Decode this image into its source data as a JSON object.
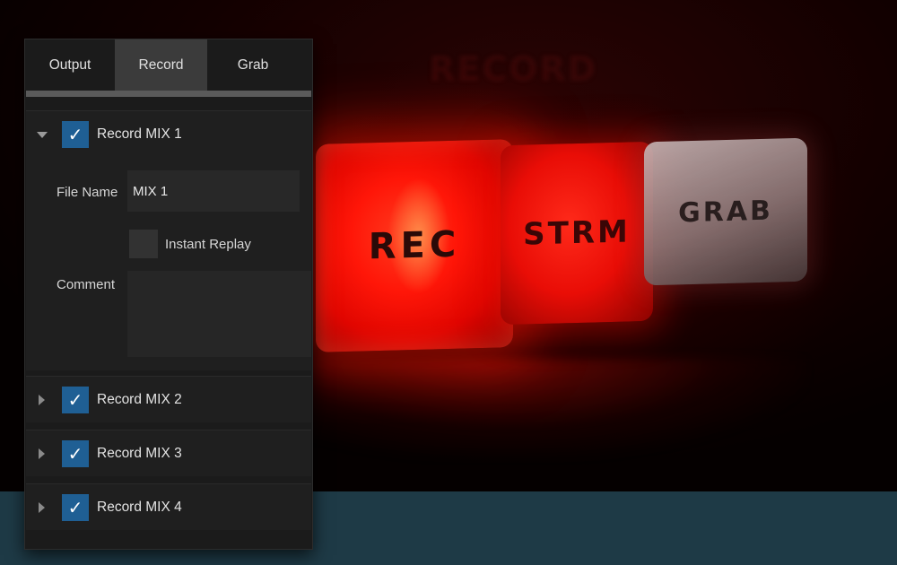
{
  "background": {
    "watermark": "RECORD",
    "keys": [
      {
        "label": "REC"
      },
      {
        "label": "STRM"
      },
      {
        "label": "GRAB"
      }
    ]
  },
  "panel": {
    "tabs": [
      {
        "label": "Output",
        "active": false
      },
      {
        "label": "Record",
        "active": true
      },
      {
        "label": "Grab",
        "active": false
      }
    ],
    "sections": [
      {
        "title": "Record MIX 1",
        "checked": true,
        "expanded": true,
        "file_name_label": "File Name",
        "file_name_value": "MIX 1",
        "instant_replay_label": "Instant Replay",
        "instant_replay_checked": false,
        "comment_label": "Comment",
        "comment_value": ""
      },
      {
        "title": "Record MIX 2",
        "checked": true,
        "expanded": false
      },
      {
        "title": "Record MIX 3",
        "checked": true,
        "expanded": false
      },
      {
        "title": "Record MIX 4",
        "checked": true,
        "expanded": false
      }
    ]
  },
  "colors": {
    "checkbox_blue": "#1f5f94",
    "bottom_band": "#1e3a46",
    "rec_red": "#ff1608"
  },
  "icons": {
    "expanded": "chevron-down-icon",
    "collapsed": "chevron-right-icon",
    "check": "checkmark-icon"
  }
}
